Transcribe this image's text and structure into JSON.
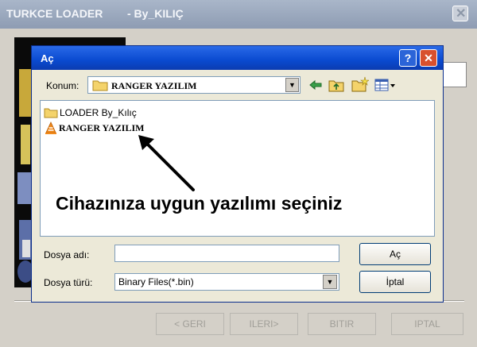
{
  "outer_window": {
    "title": "TURKCE LOADER",
    "subtitle": "- By_KILIÇ",
    "nav_buttons": {
      "back": "< GERI",
      "next": "ILERI>",
      "finish": "BITIR",
      "cancel": "IPTAL"
    }
  },
  "dialog": {
    "title": "Aç",
    "location_label": "Konum:",
    "location_value": "RANGER YAZILIM",
    "files": [
      {
        "name": "LOADER By_Kılıç",
        "icon": "folder-icon"
      },
      {
        "name": "RANGER YAZILIM",
        "icon": "vlc-cone-icon"
      }
    ],
    "annotation": "Cihazınıza uygun yazılımı seçiniz",
    "filename_label": "Dosya adı:",
    "filename_value": "",
    "filetype_label": "Dosya türü:",
    "filetype_value": "Binary Files(*.bin)",
    "open_button": "Aç",
    "cancel_button": "İptal"
  },
  "colors": {
    "dialog_title_bar": "#0a4ad0",
    "close_button": "#d8502e",
    "outer_title_bar": "#8e9cb3"
  }
}
